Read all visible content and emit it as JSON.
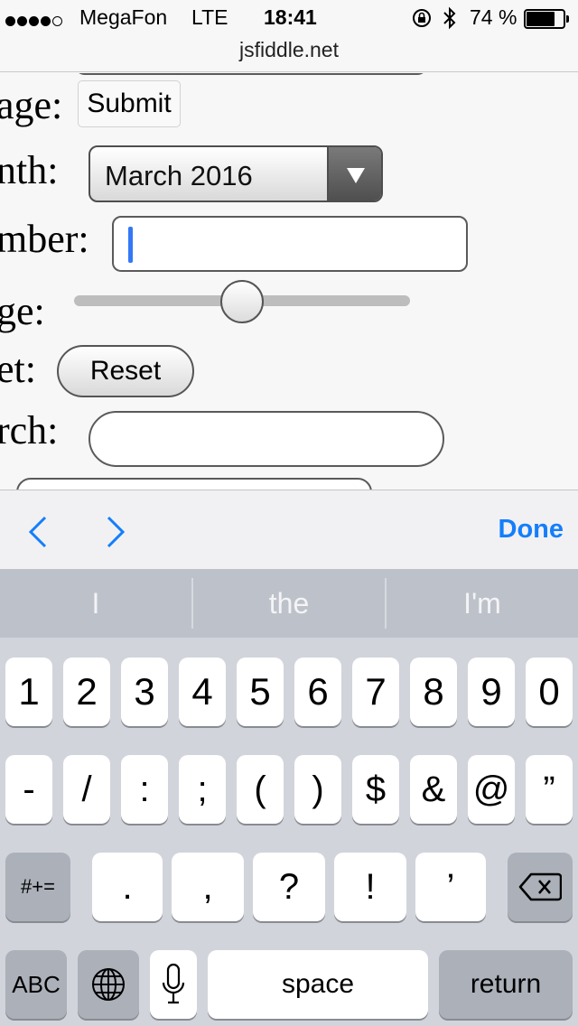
{
  "status_bar": {
    "carrier": "MegaFon",
    "network": "LTE",
    "time": "18:41",
    "battery": "74 %"
  },
  "browser": {
    "url": "jsfiddle.net"
  },
  "form": {
    "label_image": "age:",
    "submit_label": "Submit",
    "label_month": "nth:",
    "month_value": "March 2016",
    "label_number": "mber:",
    "label_range": "ge:",
    "range_fraction": 0.5,
    "label_reset": "et:",
    "reset_label": "Reset",
    "label_search": "rch:"
  },
  "accessory": {
    "done_label": "Done"
  },
  "predictions": [
    "I",
    "the",
    "I'm"
  ],
  "keyboard": {
    "row1": [
      "1",
      "2",
      "3",
      "4",
      "5",
      "6",
      "7",
      "8",
      "9",
      "0"
    ],
    "row2": [
      "-",
      "/",
      ":",
      ";",
      "(",
      ")",
      "$",
      "&",
      "@",
      "”"
    ],
    "row3": [
      "#+=",
      ".",
      ",",
      "?",
      "!",
      "’"
    ],
    "abc_label": "ABC",
    "space_label": "space",
    "return_label": "return"
  },
  "colors": {
    "accent": "#147efb",
    "caret": "#3478f6",
    "keyboard_bg": "#d1d4db"
  }
}
